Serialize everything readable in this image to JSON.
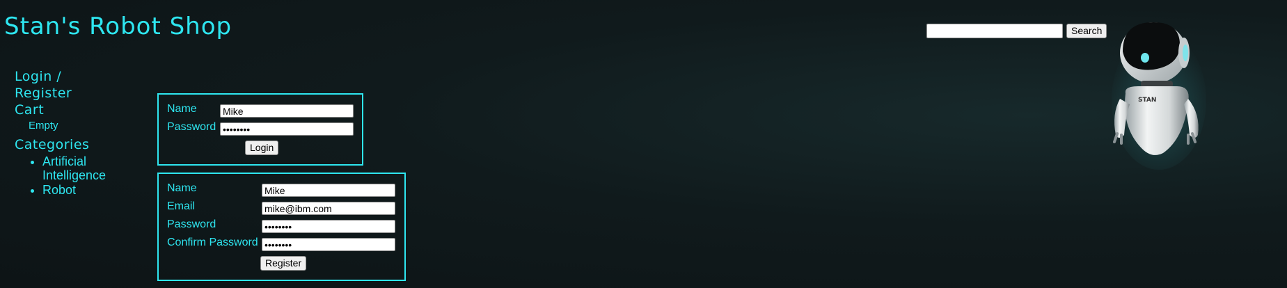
{
  "site": {
    "title": "Stan's Robot Shop"
  },
  "search": {
    "value": "",
    "placeholder": "",
    "button_label": "Search"
  },
  "robot": {
    "badge_text": "STAN"
  },
  "sidebar": {
    "login_label": "Login /",
    "register_label": "Register",
    "cart_label": "Cart",
    "cart_status": "Empty",
    "categories_label": "Categories",
    "categories": [
      {
        "line1": "Artificial",
        "line2": "Intelligence"
      },
      {
        "line1": "Robot",
        "line2": ""
      }
    ]
  },
  "login_form": {
    "name_label": "Name",
    "name_value": "Mike",
    "password_label": "Password",
    "password_value": "password",
    "button_label": "Login"
  },
  "register_form": {
    "name_label": "Name",
    "name_value": "Mike",
    "email_label": "Email",
    "email_value": "mike@ibm.com",
    "password_label": "Password",
    "password_value": "password",
    "confirm_label": "Confirm Password",
    "confirm_value": "password",
    "button_label": "Register"
  },
  "colors": {
    "accent": "#2ee6f0",
    "background": "#0f1719"
  }
}
